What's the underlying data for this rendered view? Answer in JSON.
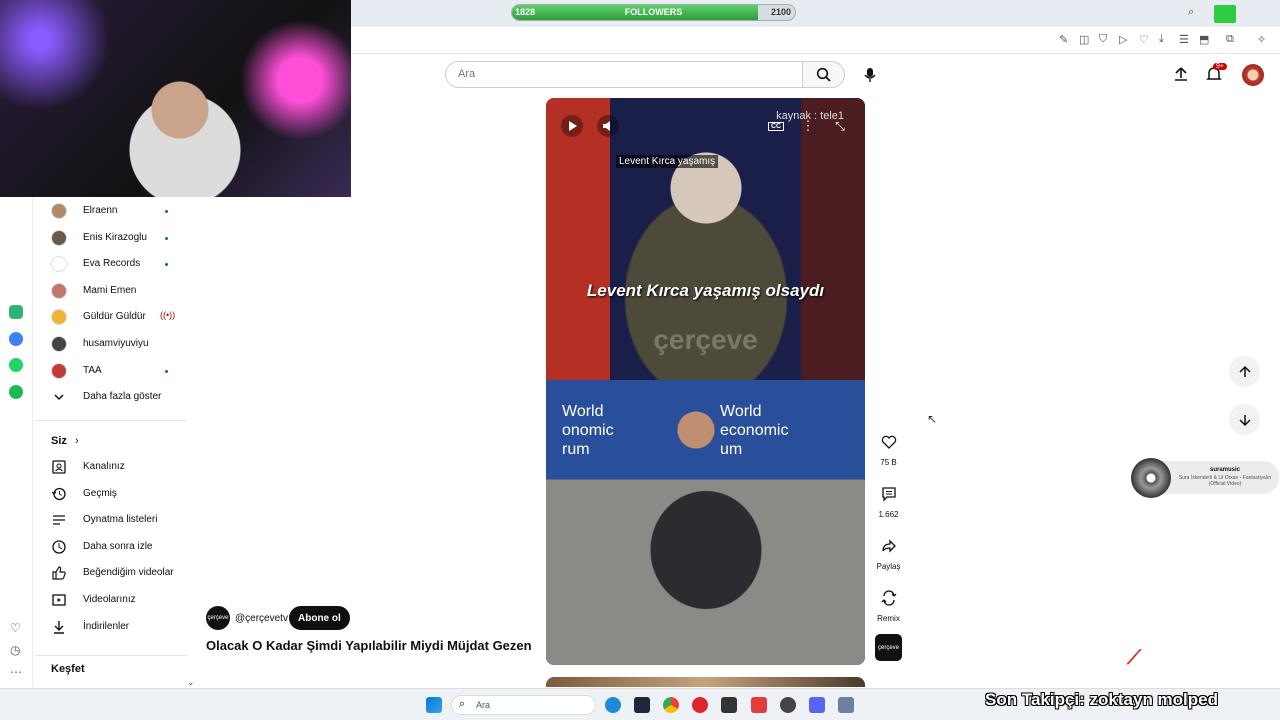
{
  "overlay": {
    "followers_title": "FOLLOWERS",
    "followers_current": "1828",
    "followers_goal": "2100",
    "followers_fraction": 0.87,
    "ticker": "Son Takipçi: zoktayn molped"
  },
  "search": {
    "placeholder": "Ara"
  },
  "header": {
    "notification_badge": "9+"
  },
  "subscriptions": [
    {
      "name": "Elraenn",
      "indicator": "dot",
      "color": "#b08a6a"
    },
    {
      "name": "Enis Kirazoglu",
      "indicator": "dot",
      "color": "#6a5a4a"
    },
    {
      "name": "Eva Records",
      "indicator": "dot",
      "color": "#ffffff"
    },
    {
      "name": "Mami Emen",
      "indicator": "",
      "color": "#c0786a"
    },
    {
      "name": "Güldür Güldür",
      "indicator": "live",
      "color": "#f2b233"
    },
    {
      "name": "husamviyuviyu",
      "indicator": "",
      "color": "#444444"
    },
    {
      "name": "TAA",
      "indicator": "dot",
      "color": "#c23b3b"
    }
  ],
  "sidebar": {
    "show_more": "Daha fazla göster",
    "you_section": "Siz",
    "you_items": [
      {
        "label": "Kanalınız",
        "icon": "channel-icon"
      },
      {
        "label": "Geçmiş",
        "icon": "history-icon"
      },
      {
        "label": "Oynatma listeleri",
        "icon": "playlists-icon"
      },
      {
        "label": "Daha sonra izle",
        "icon": "watch-later-icon"
      },
      {
        "label": "Beğendiğim videolar",
        "icon": "like-icon"
      },
      {
        "label": "Videolarınız",
        "icon": "your-videos-icon"
      },
      {
        "label": "İndirilenler",
        "icon": "download-icon"
      }
    ],
    "explore_section": "Keşfet"
  },
  "video": {
    "caption_top": "Levent Kırca yaşamış",
    "caption_main": "Levent Kırca yaşamış olsaydı",
    "source": "kaynak : tele1",
    "watermark": "çerçeve",
    "wef_left": "World\nonomic\nrum",
    "wef_right": "World\neconomic\num"
  },
  "actions": {
    "likes": "75 B",
    "comments": "1.662",
    "share": "Paylaş",
    "remix": "Remix"
  },
  "channel": {
    "avatar_text": "çerçeve",
    "handle": "@çerçevetv",
    "subscribe": "Abone ol"
  },
  "title": "Olacak O Kadar Şimdi Yapılabilir Miydi Müjdat Gezen",
  "now_playing": {
    "user": "suramusic",
    "song": "Sura İskenderli & Lil Orxan - Fantastiyalın (Official Video)"
  },
  "taskbar": {
    "search_label": "Ara"
  }
}
